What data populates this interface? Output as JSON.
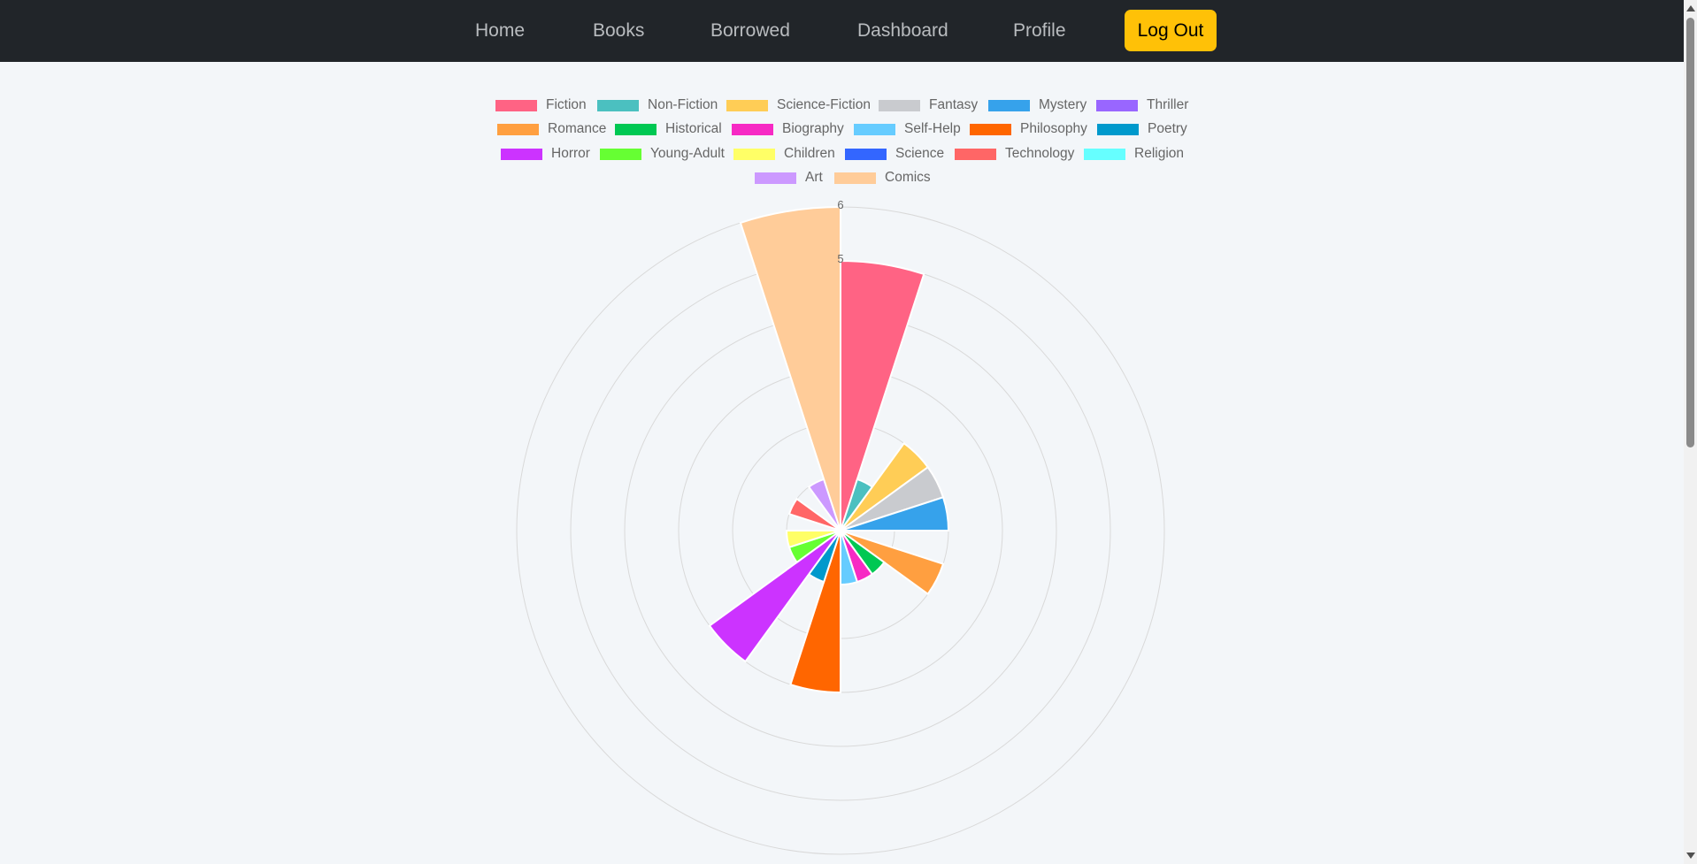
{
  "nav": {
    "items": [
      "Home",
      "Books",
      "Borrowed",
      "Dashboard",
      "Profile"
    ],
    "logout_label": "Log Out",
    "logout_color": "#ffc107",
    "background": "#212529"
  },
  "chart_data": {
    "type": "polarArea",
    "title": "",
    "categories": [
      "Fiction",
      "Non-Fiction",
      "Science-Fiction",
      "Fantasy",
      "Mystery",
      "Thriller",
      "Romance",
      "Historical",
      "Biography",
      "Self-Help",
      "Philosophy",
      "Poetry",
      "Horror",
      "Young-Adult",
      "Children",
      "Science",
      "Technology",
      "Religion",
      "Art",
      "Comics"
    ],
    "values": [
      5,
      1,
      2,
      2,
      2,
      0,
      2,
      1,
      1,
      1,
      3,
      1,
      3,
      1,
      1,
      0,
      1,
      0,
      1,
      6
    ],
    "colors": [
      "#ff6384",
      "#4bc0c0",
      "#ffcd56",
      "#c9cbcf",
      "#36a2eb",
      "#9966ff",
      "#ff9f40",
      "#00c853",
      "#f72ac4",
      "#66ccff",
      "#ff6600",
      "#0099cc",
      "#cc33ff",
      "#66ff33",
      "#ffff66",
      "#3366ff",
      "#ff6666",
      "#66ffff",
      "#cc99ff",
      "#ffcc99"
    ],
    "r_max": 6,
    "r_ticks": [
      "6",
      "5"
    ],
    "grid": true,
    "legend_position": "top"
  }
}
